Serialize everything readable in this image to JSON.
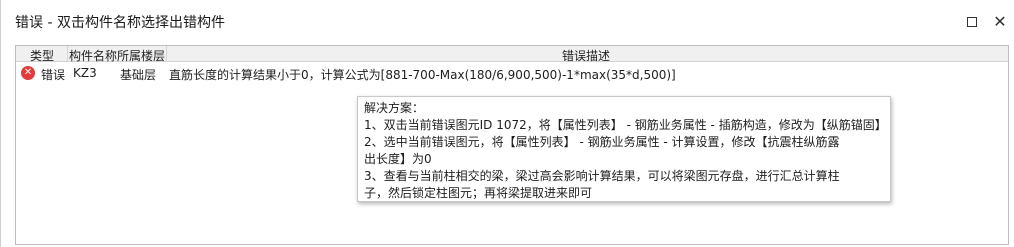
{
  "window": {
    "title": "错误 - 双击构件名称选择出错构件"
  },
  "table": {
    "headers": {
      "type": "类型",
      "name": "构件名称",
      "floor": "所属楼层",
      "desc": "错误描述"
    },
    "rows": [
      {
        "type": "错误",
        "name": "KZ3",
        "floor": "基础层",
        "desc": "直筋长度的计算结果小于0，计算公式为[881-700-Max(180/6,900,500)-1*max(35*d,500)]"
      }
    ]
  },
  "tooltip": {
    "lines": [
      "解决方案：",
      "1、双击当前错误图元ID 1072，将【属性列表】 - 钢筋业务属性 - 插筋构造，修改为【纵筋锚固】",
      "2、选中当前错误图元，将【属性列表】 - 钢筋业务属性 - 计算设置，修改【抗震柱纵筋露",
      "出长度】为0",
      "3、查看与当前柱相交的梁，梁过高会影响计算结果，可以将梁图元存盘，进行汇总计算柱",
      "子，然后锁定柱图元；再将梁提取进来即可"
    ]
  },
  "icons": {
    "error": "error-circle-icon",
    "maximize": "maximize-icon",
    "close": "close-icon"
  },
  "colors": {
    "error_red": "#e23b3b",
    "header_bg": "#f0f0f0"
  }
}
